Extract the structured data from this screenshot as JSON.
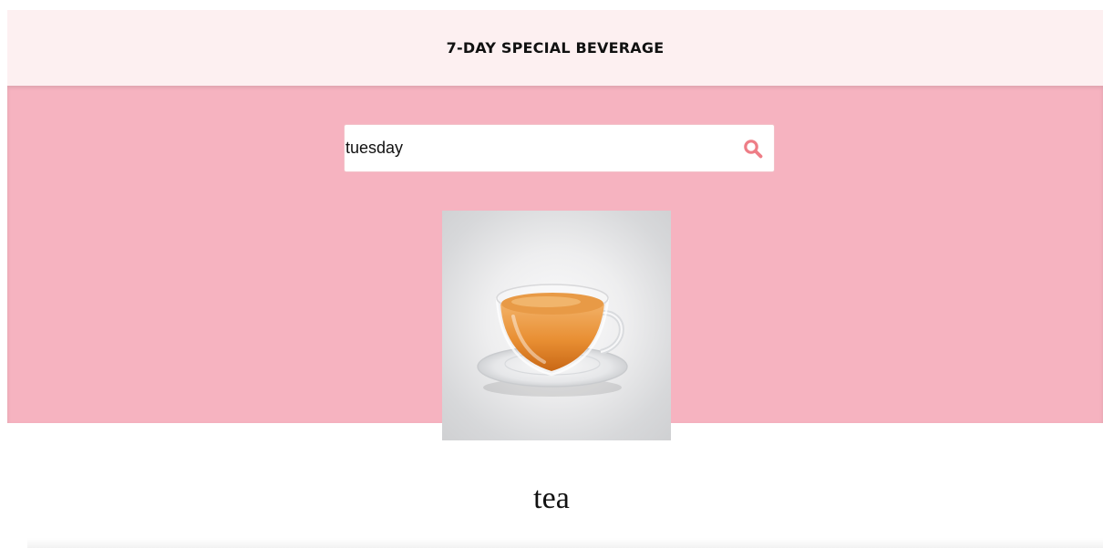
{
  "header": {
    "title": "7-DAY SPECIAL BEVERAGE"
  },
  "search": {
    "value": "tuesday",
    "icon": "search-icon",
    "icon_color": "#ee7d86"
  },
  "result": {
    "image_icon": "tea-cup",
    "drink_name": "tea"
  },
  "colors": {
    "header_bg": "#fdf0f1",
    "hero_bg": "#f6b3c0",
    "accent": "#ee7d86"
  }
}
